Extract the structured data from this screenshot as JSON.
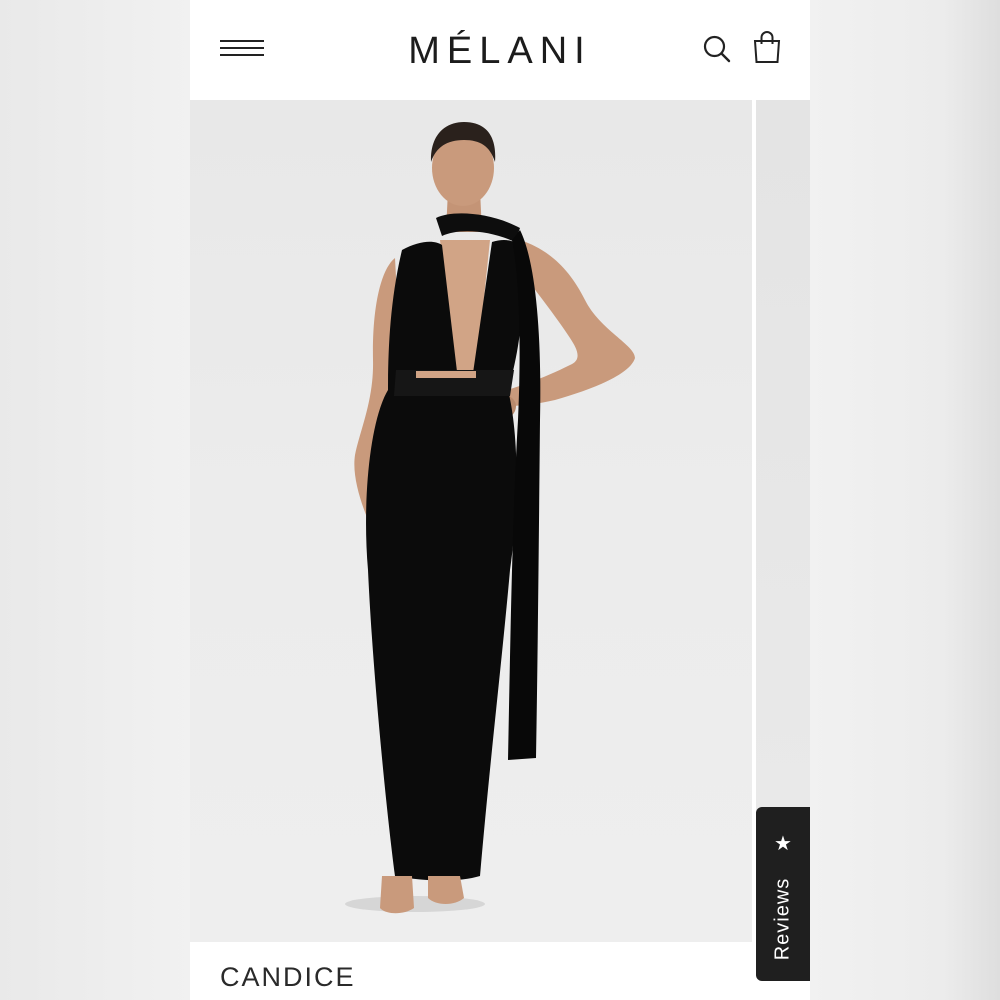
{
  "header": {
    "brand": "MÉLANI",
    "menu_icon": "hamburger-menu-icon",
    "search_icon": "search-icon",
    "bag_icon": "shopping-bag-icon"
  },
  "hero": {
    "image_subject": "model wearing black halter maxi dress",
    "background_color": "#e9e9e9"
  },
  "reviews_tab": {
    "icon": "star-icon",
    "star_glyph": "★",
    "label": "Reviews"
  },
  "product": {
    "name": "CANDICE"
  },
  "colors": {
    "header_bg": "#ffffff",
    "text": "#1c1c1c",
    "reviews_bg": "#1f1f1f",
    "dress": "#0b0b0b",
    "skin": "#c99a7c"
  }
}
